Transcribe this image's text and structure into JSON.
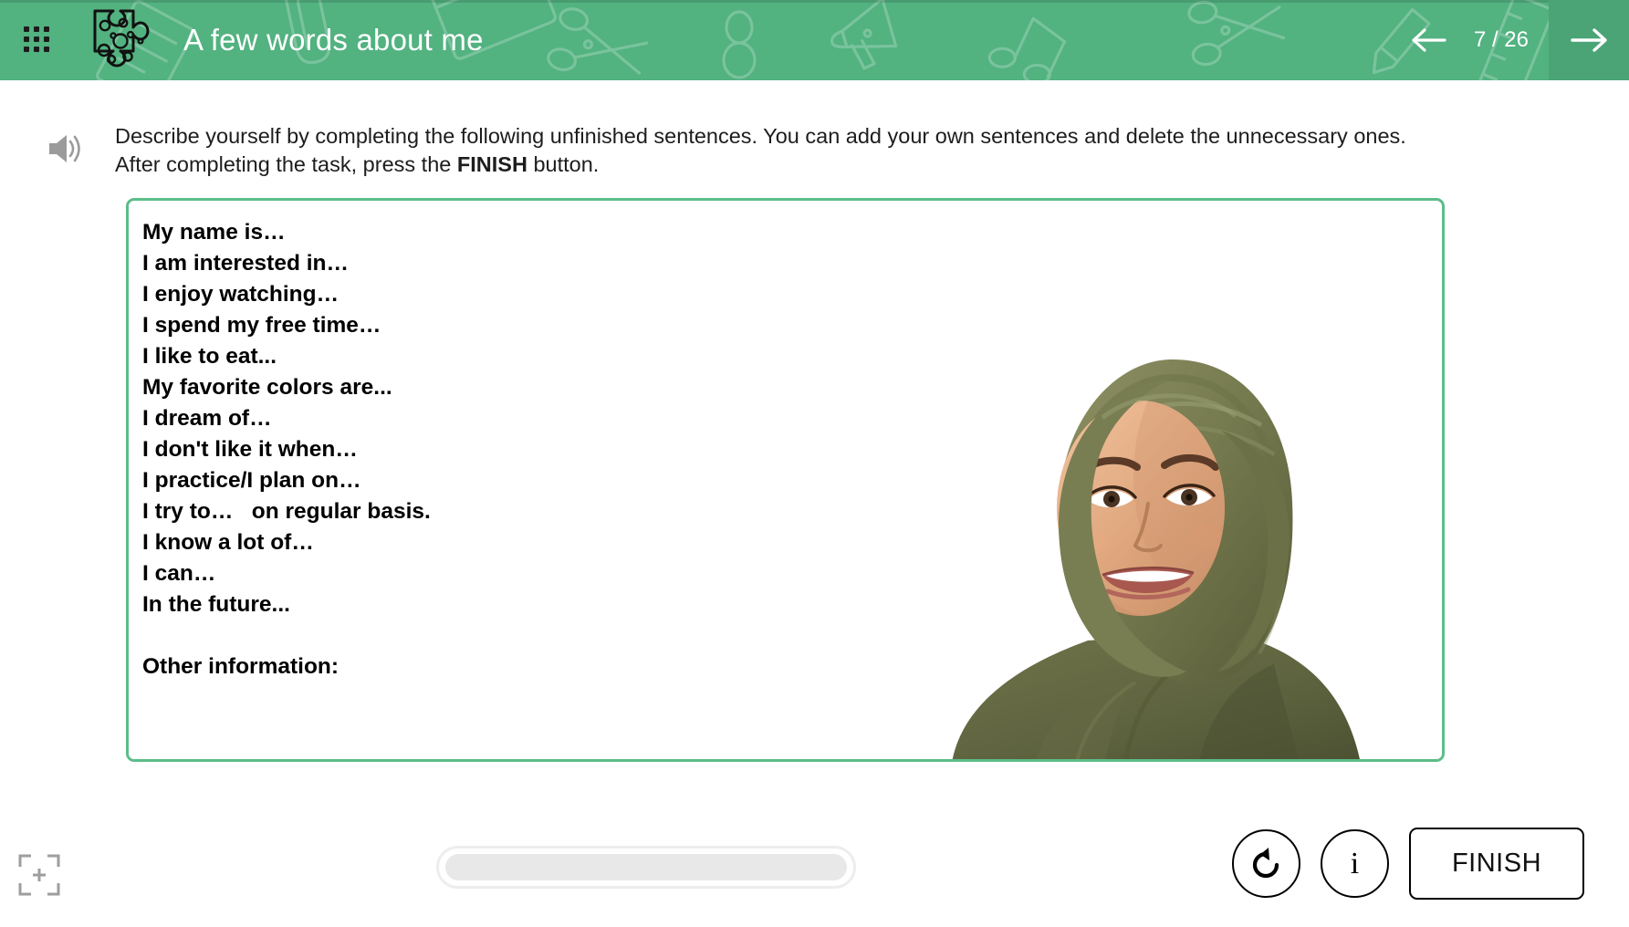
{
  "header": {
    "title": "A few words about me",
    "apps_icon": "apps-grid-icon",
    "logo_icon": "puzzle-piece-icon",
    "prev_icon": "arrow-left-icon",
    "next_icon": "arrow-right-icon",
    "page_counter": "7 / 26",
    "current_page": 7,
    "total_pages": 26,
    "bg_color": "#52b280",
    "next_bg_color": "#4aa476",
    "title_color": "#ffffff"
  },
  "instruction": {
    "speaker_icon": "speaker-sound-icon",
    "part1": "Describe yourself by completing the following unfinished sentences. You can add your own sentences and delete the unnecessary ones. After completing the task, press the ",
    "emphasis": "FINISH",
    "part2": " button."
  },
  "answer_box": {
    "border_color": "#5cbd89",
    "prompts": [
      "My name is…",
      "I am interested in…",
      "I enjoy watching…",
      "I spend my free time…",
      "I like to eat...",
      "My favorite colors are...",
      "I dream of…",
      "I don't like it when…",
      "I practice/I plan on…",
      "I try to…   on regular basis.",
      "I know a lot of…",
      "I can…",
      "In the future...",
      "",
      "Other information:"
    ],
    "prompts_text": "My name is…\nI am interested in…\nI enjoy watching…\nI spend my free time…\nI like to eat...\nMy favorite colors are...\nI dream of…\nI don't like it when…\nI practice/I plan on…\nI try to…   on regular basis.\nI know a lot of…\nI can…\nIn the future...\n\nOther information:",
    "illustration": "smiling-woman-in-olive-hijab-photo"
  },
  "footer": {
    "fullscreen_icon": "fullscreen-zoom-in-icon",
    "progress_percent": 0,
    "reset_icon": "reset-counterclockwise-icon",
    "info_icon": "info-icon",
    "info_glyph": "i",
    "finish_label": "FINISH"
  }
}
